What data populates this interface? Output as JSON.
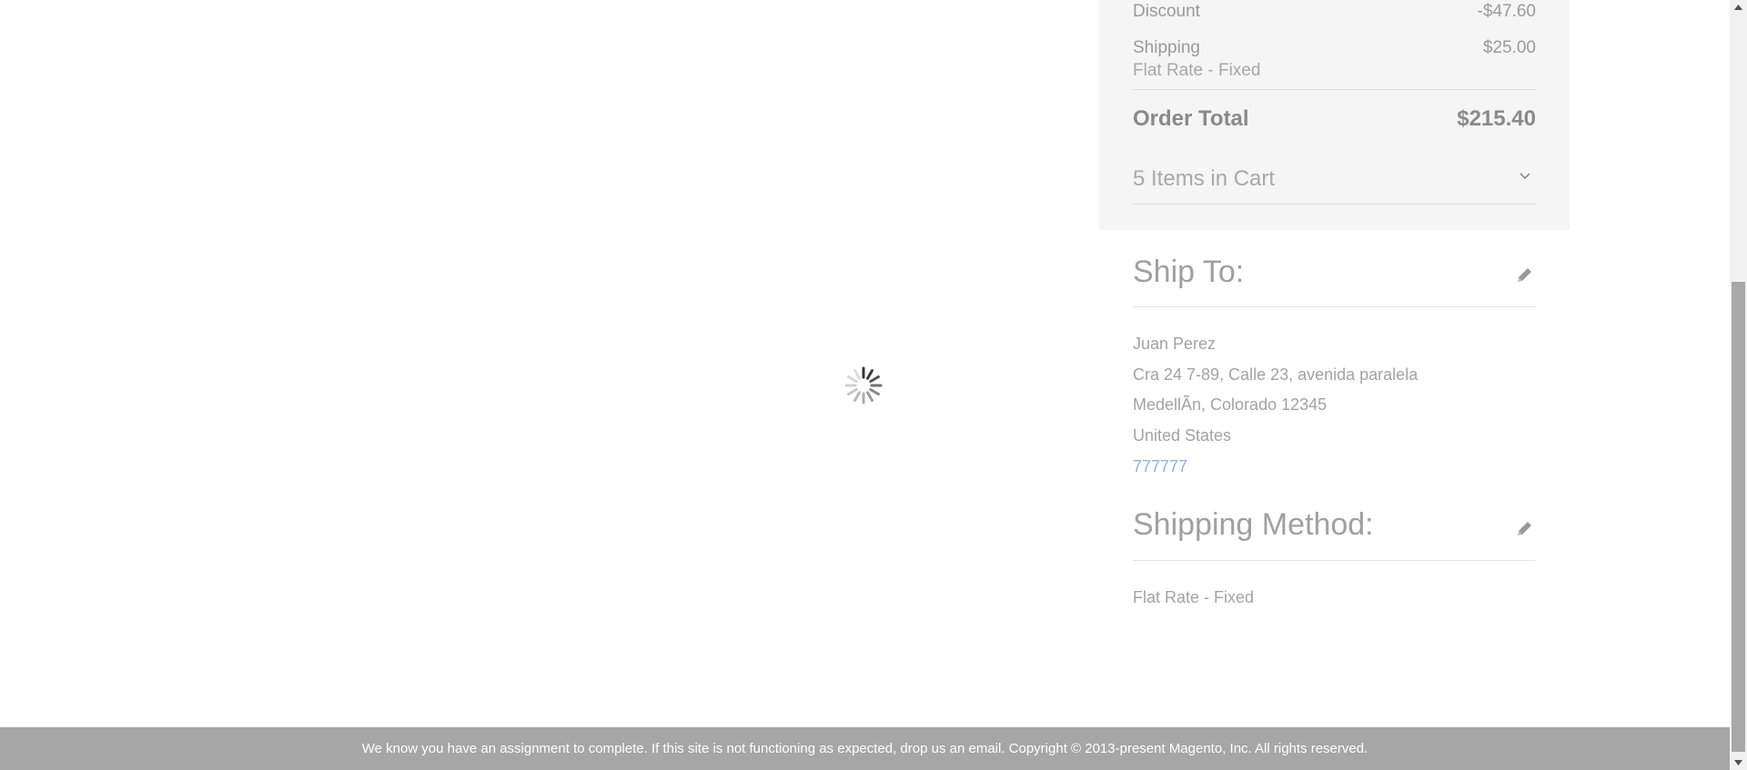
{
  "summary": {
    "discount_label": "Discount",
    "discount_value": "-$47.60",
    "shipping_label": "Shipping",
    "shipping_value": "$25.00",
    "shipping_method": "Flat Rate - Fixed",
    "order_total_label": "Order Total",
    "order_total_value": "$215.40",
    "cart_items_label": "5 Items in Cart"
  },
  "ship_to": {
    "title": "Ship To:",
    "name": "Juan Perez",
    "street": "Cra 24 7-89, Calle 23, avenida paralela",
    "city_line": "MedellÃn, Colorado 12345",
    "country": "United States",
    "phone": "777777"
  },
  "shipping_method": {
    "title": "Shipping Method:",
    "value": "Flat Rate - Fixed"
  },
  "footer": {
    "text": "We know you have an assignment to complete. If this site is not functioning as expected, drop us an email. Copyright © 2013-present Magento, Inc. All rights reserved."
  },
  "icons": {
    "edit": "pencil-icon",
    "cart_toggle": "chevron-down-icon",
    "loading": "loading-spinner-icon"
  },
  "colors": {
    "summary_bg": "#f5f5f5",
    "footer_bg": "#a6a6a6",
    "link": "#8fb4d6",
    "text_muted": "#a3a3a3"
  }
}
